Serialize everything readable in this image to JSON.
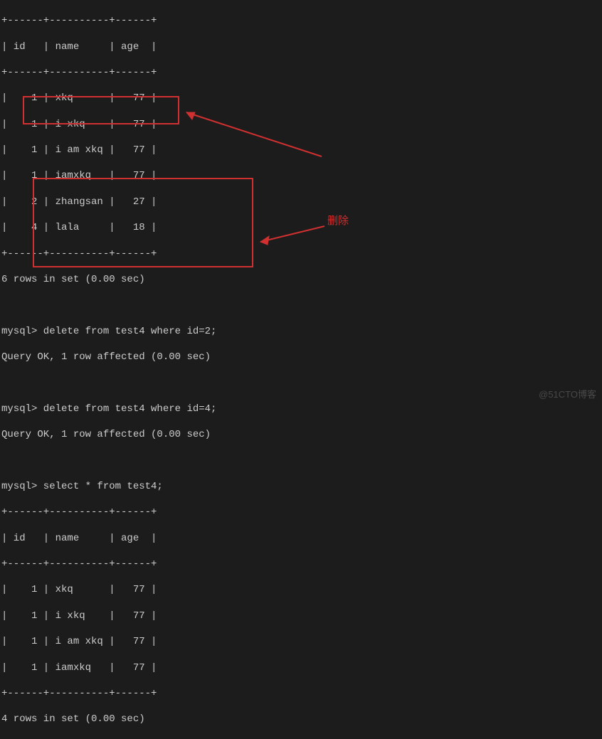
{
  "table1": {
    "border": "+------+----------+------+",
    "header": "| id   | name     | age  |",
    "rows": [
      "|    1 | xkq      |   77 |",
      "|    1 | i xkq    |   77 |",
      "|    1 | i am xkq |   77 |",
      "|    1 | iamxkq   |   77 |",
      "|    2 | zhangsan |   27 |",
      "|    4 | lala     |   18 |"
    ],
    "footer": "6 rows in set (0.00 sec)"
  },
  "delete1": {
    "prompt": "mysql> delete from test4 where id=2;",
    "result": "Query OK, 1 row affected (0.00 sec)"
  },
  "delete2": {
    "prompt": "mysql> delete from test4 where id=4;",
    "result": "Query OK, 1 row affected (0.00 sec)"
  },
  "select2": {
    "prompt": "mysql> select * from test4;"
  },
  "table2": {
    "border": "+------+----------+------+",
    "header": "| id   | name     | age  |",
    "rows": [
      "|    1 | xkq      |   77 |",
      "|    1 | i xkq    |   77 |",
      "|    1 | i am xkq |   77 |",
      "|    1 | iamxkq   |   77 |"
    ],
    "footer": "4 rows in set (0.00 sec)"
  },
  "annotation": "删除",
  "watermark": "@51CTO博客",
  "colors": {
    "accent": "#d03030",
    "bg": "#1c1c1c",
    "fg": "#cccccc"
  }
}
